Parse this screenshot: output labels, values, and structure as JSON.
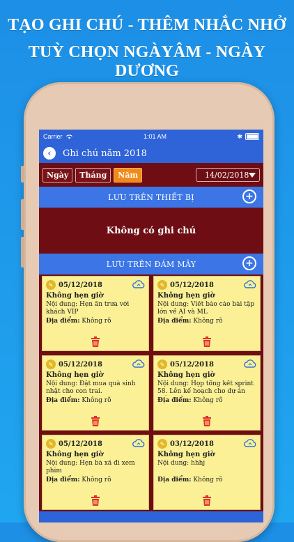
{
  "promo": {
    "line1": "TẠO GHI CHÚ - THÊM NHẮC NHỞ",
    "line2": "TUỲ CHỌN NGÀYÂM - NGÀY DƯƠNG"
  },
  "statusbar": {
    "carrier": "Carrier",
    "time": "1:01 AM"
  },
  "navbar": {
    "title": "Ghi chú năm 2018"
  },
  "filters": {
    "day": "Ngày",
    "month": "Tháng",
    "year": "Năm",
    "active": "year",
    "date": "14/02/2018"
  },
  "device_section": {
    "title": "LƯU TRÊN THIẾT BỊ",
    "empty_text": "Không có ghi chú"
  },
  "cloud_section": {
    "title": "LƯU TRÊN ĐÁM MÂY"
  },
  "notes": [
    {
      "date": "05/12/2018",
      "title": "Không hẹn giờ",
      "content": "Nội dung: Hẹn ăn trưa với khách VIP",
      "location_label": "Địa điểm:",
      "location": "Không rõ"
    },
    {
      "date": "05/12/2018",
      "title": "Không hẹn giờ",
      "content": "Nội dung: Viết báo cáo bài tập lớn về AI và ML",
      "location_label": "Địa điểm:",
      "location": "Không rõ"
    },
    {
      "date": "05/12/2018",
      "title": "Không hẹn giờ",
      "content": "Nội dung: Đặt mua quà sinh nhật cho con trai.",
      "location_label": "Địa điểm:",
      "location": "Không rõ"
    },
    {
      "date": "05/12/2018",
      "title": "Không hẹn giờ",
      "content": "Nội dung: Họp tổng kết sprint 58. Lên kế hoạch cho dự án mới.",
      "location_label": "Địa điểm:",
      "location": "Không rõ"
    },
    {
      "date": "05/12/2018",
      "title": "Không hẹn giờ",
      "content": "Nội dung: Hẹn bà xã đi xem phim",
      "location_label": "Địa điểm:",
      "location": "Không rõ"
    },
    {
      "date": "03/12/2018",
      "title": "Không hẹn giờ",
      "content": "Nội dung: hhhj",
      "location_label": "Địa điểm:",
      "location": "Không rõ"
    }
  ],
  "colors": {
    "background": "#1f9be9",
    "appbar": "#2f64d8",
    "section_bar": "#3c76e6",
    "maroon": "#6e0d13",
    "active_segment": "#f28a1a",
    "note_yellow": "#fbf096",
    "trash_red": "#e0302a",
    "cloud_blue": "#2e73d8"
  }
}
